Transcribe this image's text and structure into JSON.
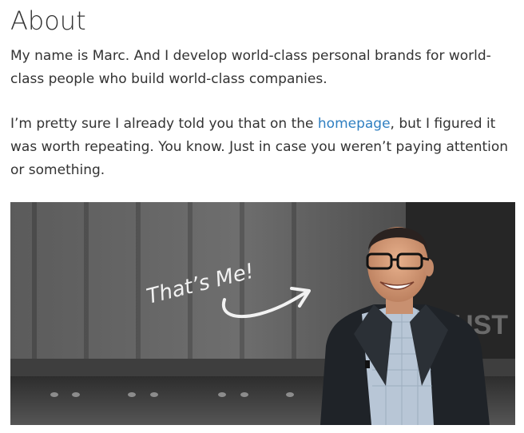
{
  "about": {
    "heading": "About",
    "para1": "My name is Marc. And I develop world-class personal brands for world-class people who build world-class companies.",
    "para2_before": "I’m pretty sure I already told you that on the ",
    "para2_link": "homepage",
    "para2_after": ", but I figured it was worth repeating. You know. Just in case you weren’t paying attention or something.",
    "photo": {
      "caption_handwritten": "That’s Me!",
      "background_letters": "UST"
    }
  }
}
